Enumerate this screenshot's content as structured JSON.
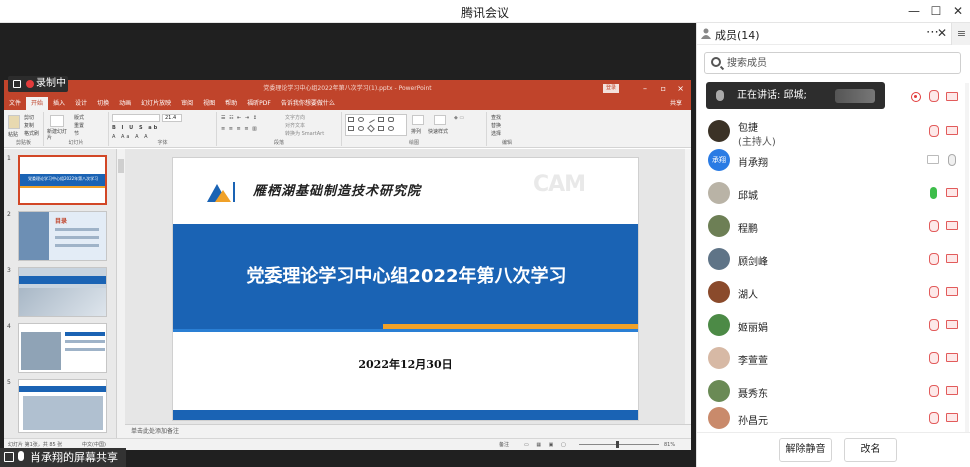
{
  "window": {
    "title": "腾讯会议"
  },
  "share": {
    "recording_label": "录制中",
    "sharer_label": "肖承翔的屏幕共享",
    "ppt": {
      "file_title": "党委理论学习中心组2022年第八次学习(1).pptx  -  PowerPoint",
      "login_label": "登录",
      "tabs": [
        "文件",
        "开始",
        "插入",
        "设计",
        "切换",
        "动画",
        "幻灯片放映",
        "审阅",
        "视图",
        "帮助",
        "福昕PDF",
        "告诉我你想要做什么"
      ],
      "share_btn": "共享",
      "groups": [
        "剪贴板",
        "幻灯片",
        "字体",
        "段落",
        "绘图",
        "编辑"
      ],
      "ribbon": {
        "paste": "粘贴",
        "cut": "剪切",
        "copy": "复制",
        "format": "格式刷",
        "new_slide": "新建幻灯片",
        "layout": "版式",
        "reset": "重置",
        "section": "节",
        "font_size": "21.4",
        "text_dir": "文字方向",
        "align_text": "对齐文本",
        "smartart": "转换为 SmartArt",
        "arrange": "排列",
        "quick_styles": "快速样式",
        "find": "查找",
        "replace": "替换",
        "select": "选择"
      },
      "thumb_numbers": [
        "1",
        "2",
        "3",
        "4",
        "5"
      ],
      "thumb_titles": [
        "党委理论学习中心组2022年第八次学习",
        "目录"
      ],
      "slide": {
        "institute": "雁栖湖基础制造技术研究院",
        "cam_logo": "CAM",
        "title": "党委理论学习中心组2022年第八次学习",
        "date": "2022年12月30日"
      },
      "notes": "单击此处添加备注",
      "status_left": "幻灯片 第1张，共 85 张",
      "status_lang": "中文(中国)",
      "status_notes": "备注",
      "zoom": "81%"
    }
  },
  "panel": {
    "title": "成员(14)",
    "search_placeholder": "搜索成员",
    "speaking": "正在讲话: 邱城;",
    "members": [
      {
        "name": "包捷",
        "role": "(主持人)",
        "avatar_color": "#3b3226"
      },
      {
        "name": "肖承翔",
        "avatar_text": "承翔",
        "avatar_color": "#2a7be4"
      },
      {
        "name": "邱城",
        "avatar_color": "#b9b3a6"
      },
      {
        "name": "程鹏",
        "avatar_color": "#6d7f55"
      },
      {
        "name": "顾剑峰",
        "avatar_color": "#5f7487"
      },
      {
        "name": "湖人",
        "avatar_color": "#8a4a2b"
      },
      {
        "name": "姬丽娟",
        "avatar_color": "#4c8a46"
      },
      {
        "name": "李萱萱",
        "avatar_color": "#d7b9a5"
      },
      {
        "name": "聂秀东",
        "avatar_color": "#6a8a55"
      },
      {
        "name": "孙昌元",
        "avatar_color": "#c98a6b"
      }
    ],
    "buttons": {
      "unmute_all": "解除静音",
      "rename": "改名"
    }
  }
}
